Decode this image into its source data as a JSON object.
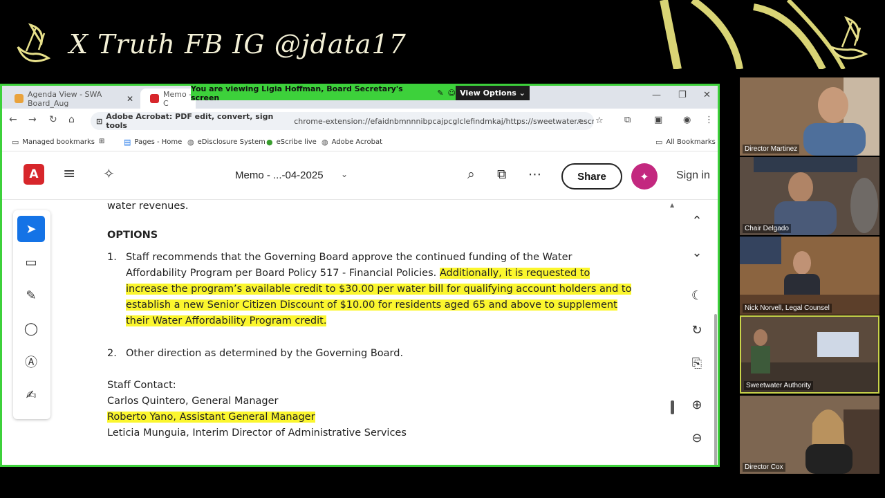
{
  "banner": {
    "text": "X Truth FB IG @jdata17"
  },
  "browser": {
    "tabs": [
      {
        "title": "Agenda View - SWA Board_Aug",
        "favicon_color": "#e9a23b"
      },
      {
        "title": "Memo - C",
        "favicon_color": "#d7262b"
      }
    ],
    "share_banner": "You are viewing  Ligia Hoffman, Board Secretary's screen",
    "view_options": "View Options",
    "site_chip": "Adobe Acrobat: PDF edit, convert, sign tools",
    "url": "chrome-extension://efaidnbmnnnibpcajpcglclefindmkaj/https://sweetwater.escribemeetin...",
    "bookmarks": [
      "Managed bookmarks",
      "Pages - Home",
      "eDisclosure System",
      "eScribe live",
      "Adobe Acrobat"
    ],
    "all_bookmarks": "All Bookmarks"
  },
  "acrobat": {
    "doc_title": "Memo - ...-04-2025",
    "share_label": "Share",
    "signin_label": "Sign in",
    "brand_color": "#d7262b"
  },
  "document": {
    "top_text": "water revenues.",
    "options_heading": "OPTIONS",
    "item1": {
      "num": "1.",
      "lines": [
        {
          "plain": "Staff recommends that the Governing Board approve the continued funding of the Water",
          "hl": ""
        },
        {
          "plain": "Affordability Program per Board Policy 517 - Financial Policies. ",
          "hl": "Additionally, it is requested to"
        },
        {
          "plain": "",
          "hl": "increase the program’s available credit to $30.00 per water bill for qualifying account holders and to"
        },
        {
          "plain": "",
          "hl": "establish a new Senior Citizen Discount of $10.00 for residents aged 65 and above to supplement"
        },
        {
          "plain": "",
          "hl": "their Water Affordability Program credit."
        }
      ]
    },
    "item2": {
      "num": "2.",
      "text": "Other direction as determined by the Governing Board."
    },
    "staff_contact_label": "Staff Contact:",
    "contacts": [
      {
        "text": "Carlos Quintero, General Manager",
        "highlighted": false
      },
      {
        "text": "Roberto Yano, Assistant General Manager",
        "highlighted": true
      },
      {
        "text": "Leticia Munguia, Interim Director of Administrative Services",
        "highlighted": false
      }
    ],
    "highlight_color": "#fbf62e"
  },
  "participants": [
    {
      "name": "Director Martinez",
      "bg": "#6d5b4c"
    },
    {
      "name": "Chair Delgado",
      "bg": "#5a4c42"
    },
    {
      "name": "Nick Norvell, Legal Counsel",
      "bg": "#7a5a3f"
    },
    {
      "name": "Sweetwater Authority",
      "bg": "#5b4a3c"
    },
    {
      "name": "Director Cox",
      "bg": "#7d6651"
    }
  ],
  "accent_color": "#3dd13b"
}
